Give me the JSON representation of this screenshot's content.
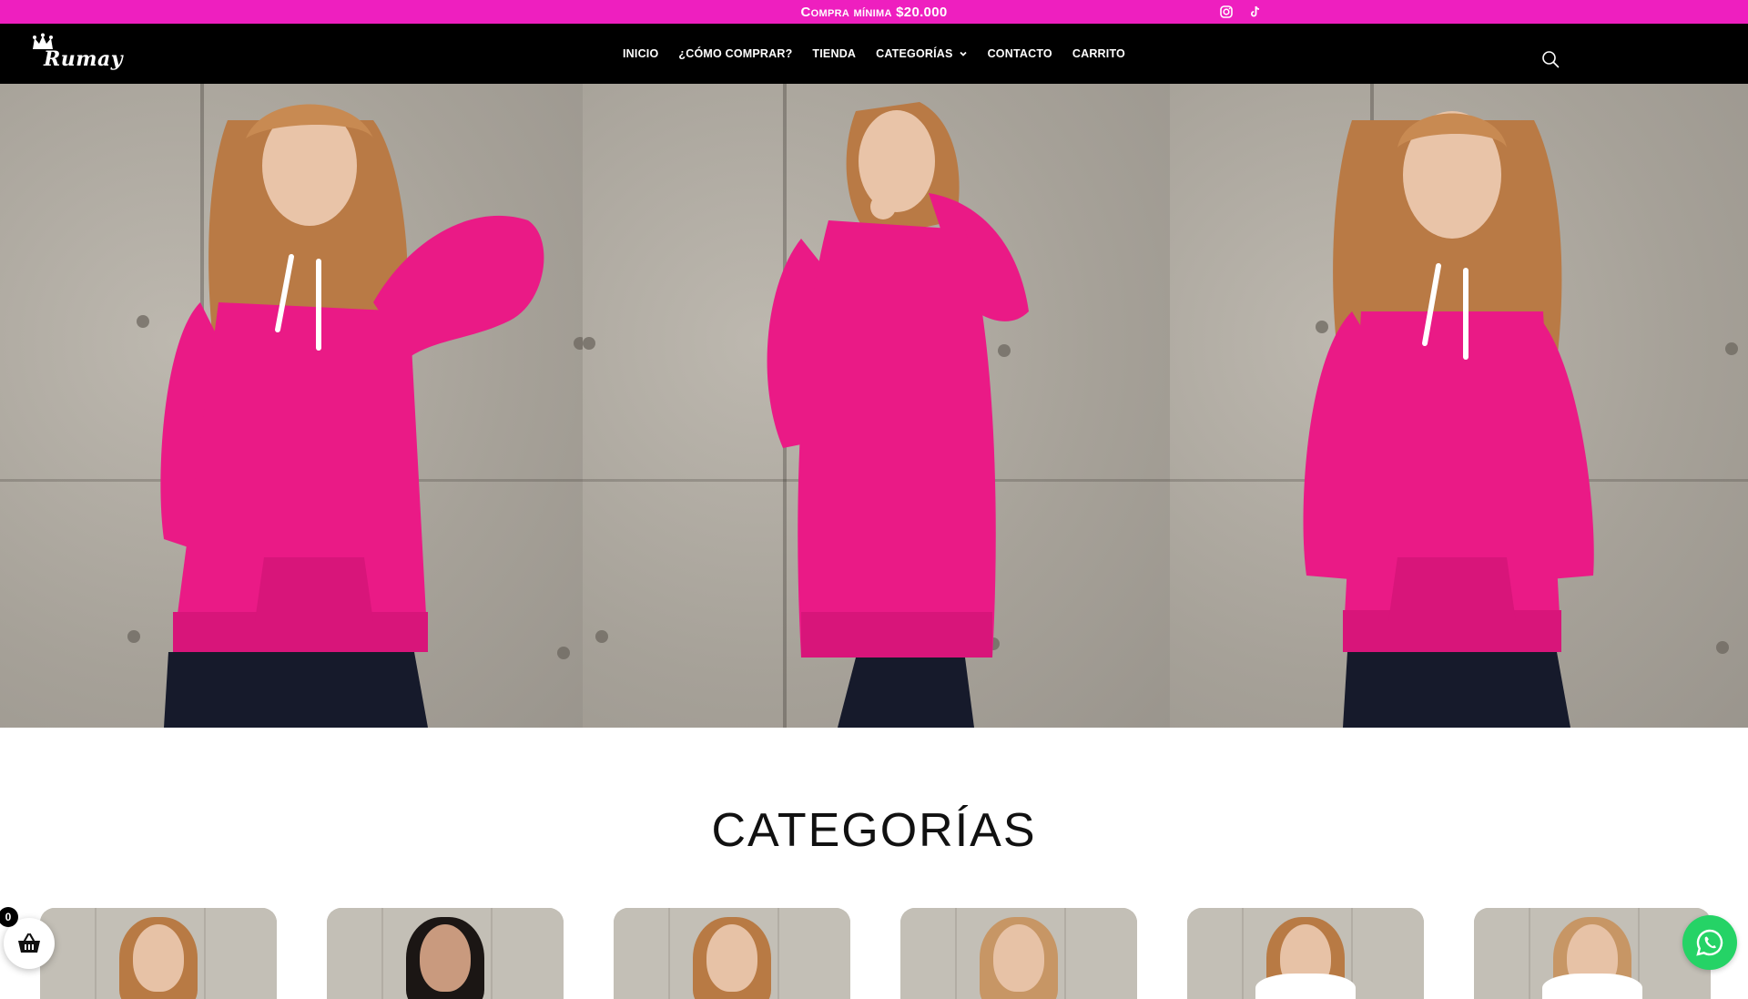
{
  "promo": {
    "text": "Compra mínima $20.000",
    "social_icons": [
      "instagram-icon",
      "tiktok-icon"
    ]
  },
  "header": {
    "logo_text": "Rumay",
    "nav": [
      {
        "label": "INICIO"
      },
      {
        "label": "¿CÓMO COMPRAR?"
      },
      {
        "label": "TIENDA"
      },
      {
        "label": "CATEGORÍAS",
        "has_dropdown": true
      },
      {
        "label": "CONTACTO"
      },
      {
        "label": "CARRITO"
      }
    ],
    "search_icon": "search-icon"
  },
  "categories": {
    "title": "CATEGORÍAS"
  },
  "cart": {
    "count": "0"
  },
  "colors": {
    "brand_pink": "#ee1fbf",
    "header_bg": "#000000",
    "whatsapp": "#25d366",
    "hoodie": "#ea1a86"
  }
}
